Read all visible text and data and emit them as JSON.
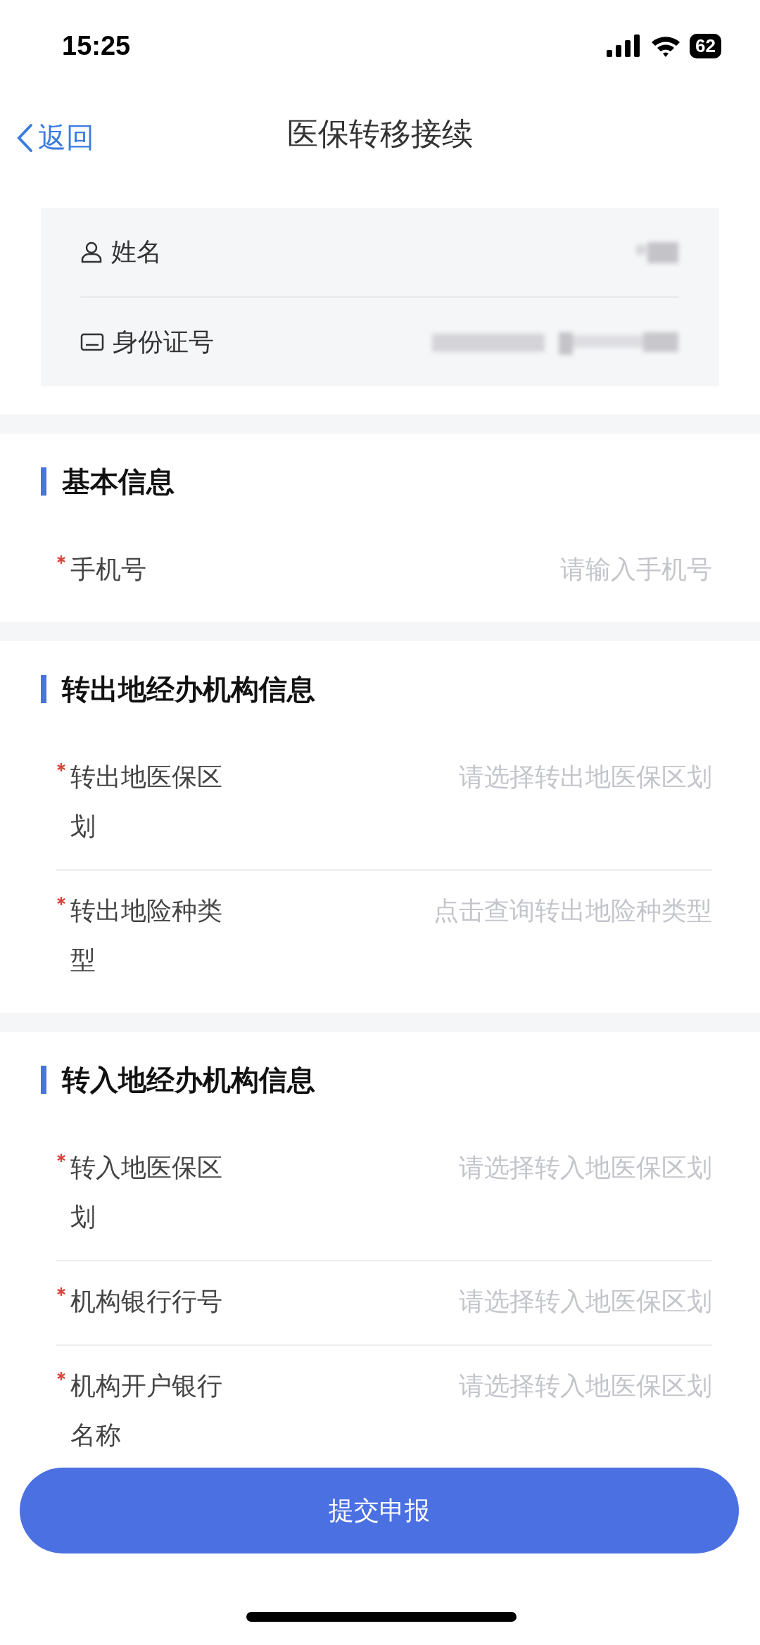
{
  "status_bar": {
    "time": "15:25",
    "battery": "62"
  },
  "nav": {
    "back": "返回",
    "title": "医保转移接续"
  },
  "identity": [
    {
      "kind": "person",
      "label": "姓名"
    },
    {
      "kind": "card",
      "label": "身份证号"
    }
  ],
  "sections": [
    {
      "title": "基本信息",
      "fields": [
        {
          "label": "手机号",
          "placeholder": "请输入手机号",
          "required": true
        }
      ]
    },
    {
      "title": "转出地经办机构信息",
      "fields": [
        {
          "label": "转出地医保区划",
          "placeholder": "请选择转出地医保区划",
          "required": true
        },
        {
          "label": "转出地险种类型",
          "placeholder": "点击查询转出地险种类型",
          "required": true
        }
      ]
    },
    {
      "title": "转入地经办机构信息",
      "fields": [
        {
          "label": "转入地医保区划",
          "placeholder": "请选择转入地医保区划",
          "required": true
        },
        {
          "label": "机构银行行号",
          "placeholder": "请选择转入地医保区划",
          "required": true
        },
        {
          "label": "机构开户银行名称",
          "placeholder": "请选择转入地医保区划",
          "required": true
        }
      ]
    }
  ],
  "submit": "提交申报"
}
